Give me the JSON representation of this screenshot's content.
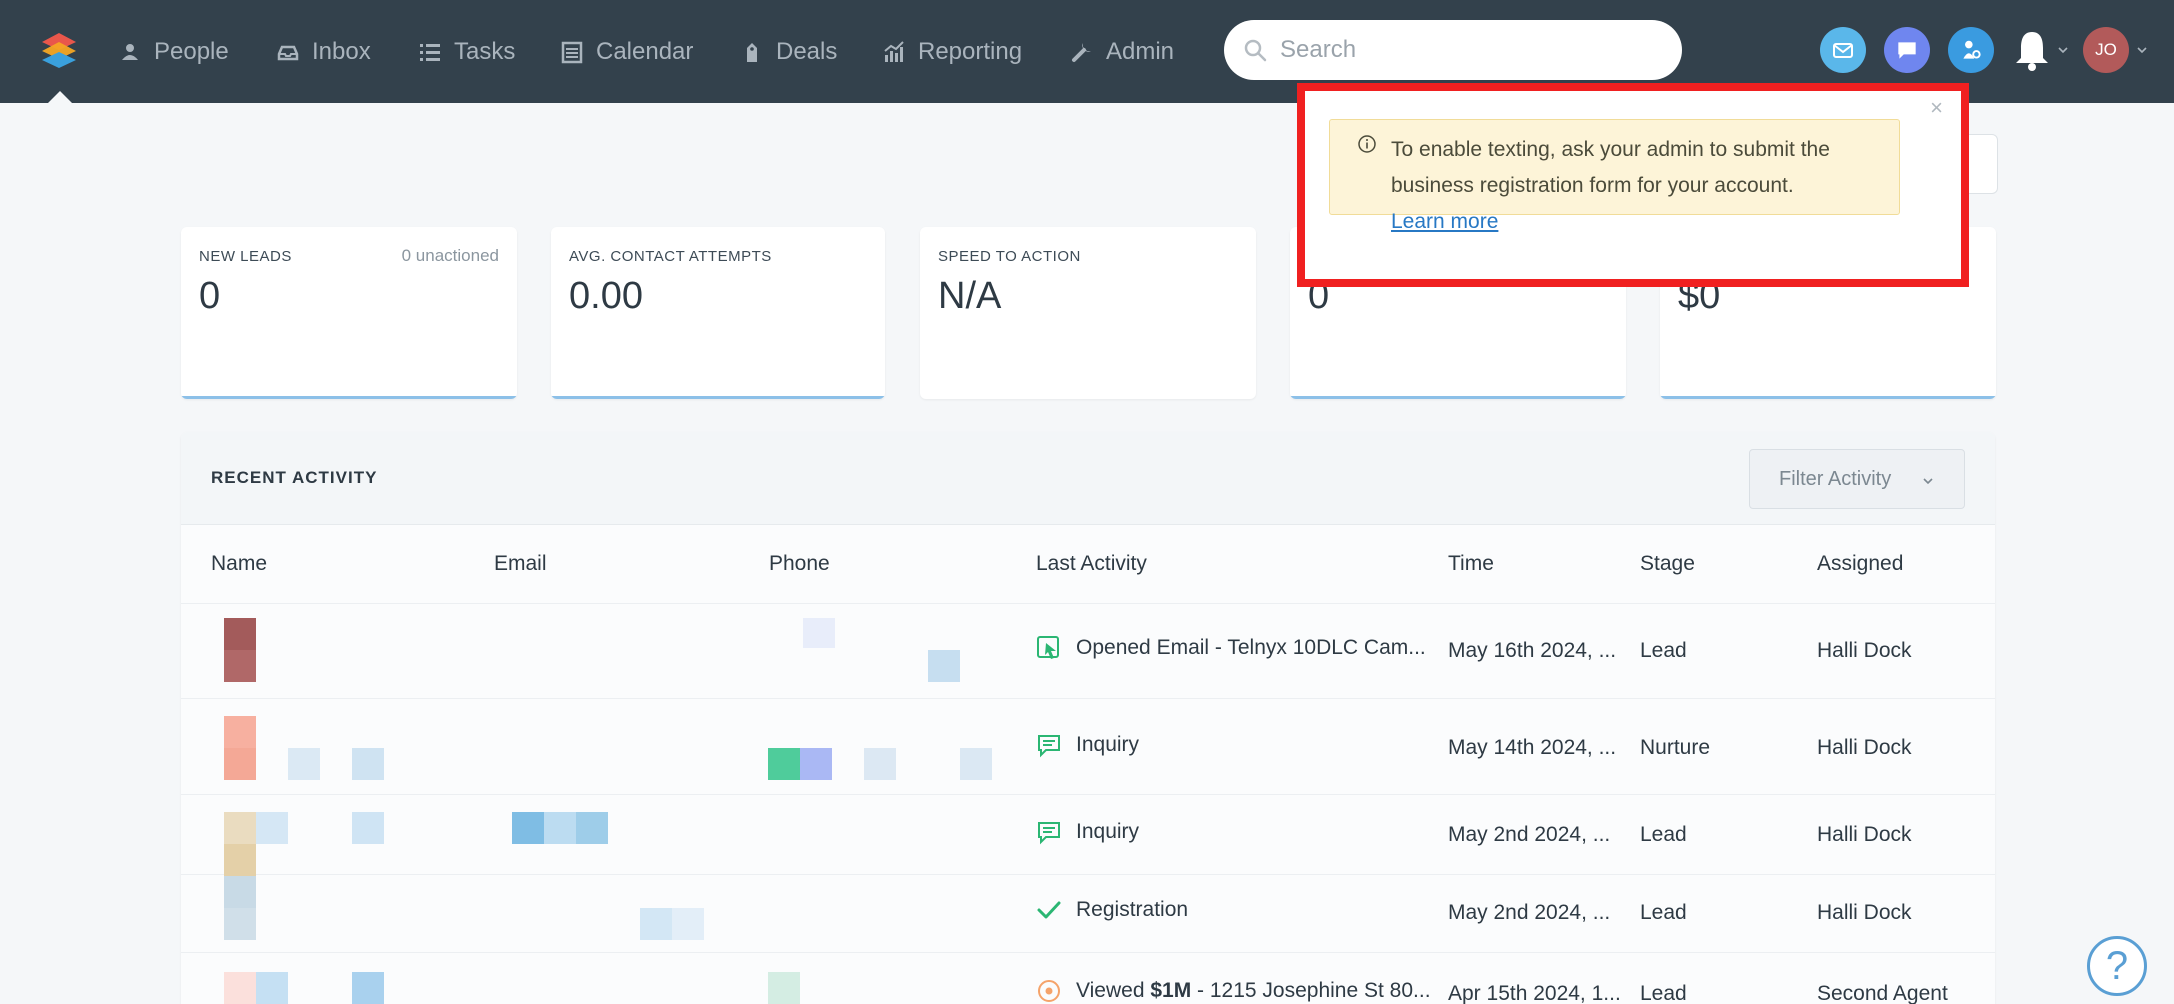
{
  "nav": {
    "items": [
      {
        "label": "People",
        "icon": "people-icon"
      },
      {
        "label": "Inbox",
        "icon": "inbox-icon"
      },
      {
        "label": "Tasks",
        "icon": "tasks-icon"
      },
      {
        "label": "Calendar",
        "icon": "calendar-icon"
      },
      {
        "label": "Deals",
        "icon": "deals-icon"
      },
      {
        "label": "Reporting",
        "icon": "reporting-icon"
      },
      {
        "label": "Admin",
        "icon": "admin-icon"
      }
    ],
    "search_placeholder": "Search",
    "avatar_initials": "JO"
  },
  "stats": [
    {
      "label": "NEW LEADS",
      "sublabel": "0 unactioned",
      "value": "0"
    },
    {
      "label": "AVG. CONTACT ATTEMPTS",
      "value": "0.00"
    },
    {
      "label": "SPEED TO ACTION",
      "value": "N/A"
    },
    {
      "value": "0"
    },
    {
      "value": "$0"
    }
  ],
  "popup": {
    "message": "To enable texting, ask your admin to submit the business registration form for your account.",
    "link": "Learn more",
    "close": "×"
  },
  "activity": {
    "title": "RECENT ACTIVITY",
    "filter_label": "Filter Activity",
    "columns": [
      "Name",
      "Email",
      "Phone",
      "Last Activity",
      "Time",
      "Stage",
      "Assigned"
    ],
    "rows": [
      {
        "activity": "Opened Email - Telnyx 10DLC Cam...",
        "icon": "cursor-click-icon",
        "time": "May 16th 2024, ...",
        "stage": "Lead",
        "assigned": "Halli Dock"
      },
      {
        "activity": "Inquiry",
        "icon": "message-icon",
        "time": "May 14th 2024, ...",
        "stage": "Nurture",
        "assigned": "Halli Dock"
      },
      {
        "activity": "Inquiry",
        "icon": "message-icon",
        "time": "May 2nd 2024, ...",
        "stage": "Lead",
        "assigned": "Halli Dock"
      },
      {
        "activity": "Registration",
        "icon": "check-icon",
        "time": "May 2nd 2024, ...",
        "stage": "Lead",
        "assigned": "Halli Dock"
      },
      {
        "activity_prefix": "Viewed ",
        "activity_bold": "$1M",
        "activity_suffix": " - 1215 Josephine St 80...",
        "icon": "eye-icon",
        "time": "Apr 15th 2024, 1...",
        "stage": "Lead",
        "assigned": "Second Agent"
      }
    ]
  },
  "help_label": "?",
  "colors": {
    "nav_bg": "#33414c",
    "accent_blue": "#8cc0e8",
    "popup_border": "#f02020",
    "popup_bg": "#fdf4d8",
    "activity_green": "#2bb673"
  }
}
